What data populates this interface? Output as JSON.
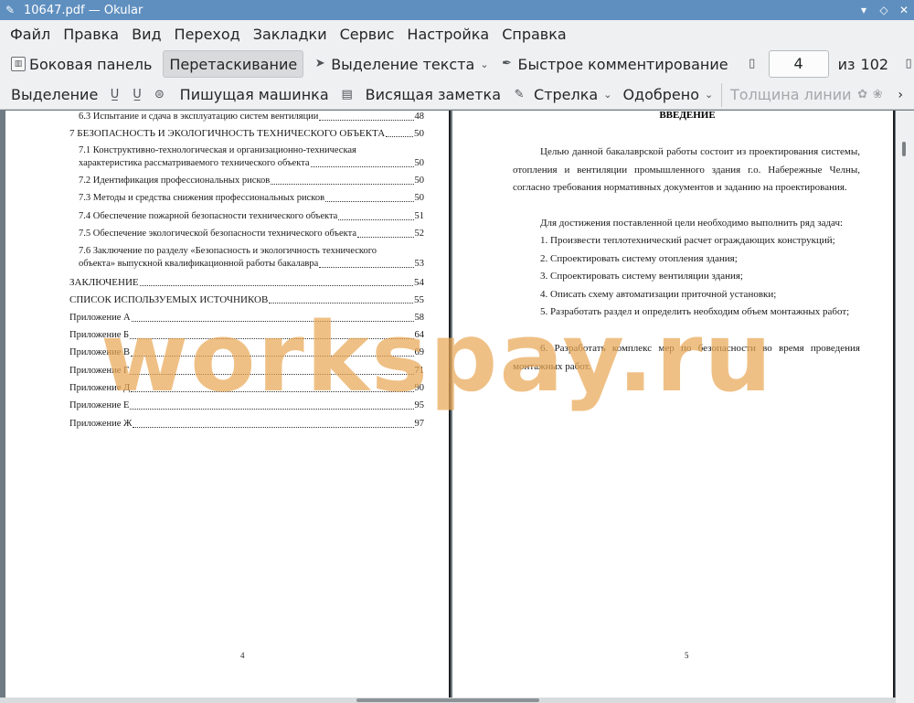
{
  "window": {
    "title": "10647.pdf  — Okular"
  },
  "menu": [
    "Файл",
    "Правка",
    "Вид",
    "Переход",
    "Закладки",
    "Сервис",
    "Настройка",
    "Справка"
  ],
  "toolbar1": {
    "sidebar": "Боковая панель",
    "drag": "Перетаскивание",
    "text_select": "Выделение текста",
    "quick_comment": "Быстрое комментирование",
    "page_current": "4",
    "page_of": "из",
    "page_total": "102"
  },
  "toolbar2": {
    "selection": "Выделение",
    "typewriter": "Пишущая машинка",
    "hanging_note": "Висящая заметка",
    "arrow": "Стрелка",
    "approved": "Одобрено",
    "line_width": "Толщина линии"
  },
  "left_page": {
    "toc": [
      {
        "text": "6.3 Испытание и сдача в эксплуатацию систем вентиляции",
        "page": "48"
      },
      {
        "text": "7 БЕЗОПАСНОСТЬ И ЭКОЛОГИЧНОСТЬ ТЕХНИЧЕСКОГО ОБЪЕКТА",
        "page": "50"
      },
      {
        "text": "7.1 Конструктивно-технологическая и организационно-техническая",
        "page": ""
      },
      {
        "text": "характеристика рассматриваемого технического объекта",
        "page": "50"
      },
      {
        "text": "7.2 Идентификация профессиональных рисков",
        "page": "50"
      },
      {
        "text": "7.3 Методы и средства снижения профессиональных рисков",
        "page": "50"
      },
      {
        "text": "7.4 Обеспечение пожарной безопасности технического объекта",
        "page": "51"
      },
      {
        "text": "7.5 Обеспечение экологической безопасности технического объекта",
        "page": "52"
      },
      {
        "text": "7.6 Заключение по разделу «Безопасность и экологичность технического",
        "page": ""
      },
      {
        "text": "объекта» выпускной квалификационной работы бакалавра",
        "page": "53"
      },
      {
        "text": "ЗАКЛЮЧЕНИЕ",
        "page": "54"
      },
      {
        "text": "СПИСОК ИСПОЛЬЗУЕМЫХ ИСТОЧНИКОВ",
        "page": "55"
      },
      {
        "text": "Приложение А",
        "page": "58"
      },
      {
        "text": "Приложение Б",
        "page": "64"
      },
      {
        "text": "Приложение В",
        "page": "69"
      },
      {
        "text": "Приложение Г",
        "page": "71"
      },
      {
        "text": "Приложение Д",
        "page": "90"
      },
      {
        "text": "Приложение Е",
        "page": "95"
      },
      {
        "text": "Приложение Ж",
        "page": "97"
      }
    ],
    "page_number": "4"
  },
  "right_page": {
    "heading": "ВВЕДЕНИЕ",
    "paragraphs": [
      "Целью данной бакалаврской работы состоит из проектирования системы, отопления и вентиляции промышленного здания г.о. Набережные Челны, согласно требования нормативных документов и заданию на проектирования.",
      "Для достижения поставленной цели необходимо выполнить ряд задач:",
      "1. Произвести теплотехнический расчет ограждающих конструкций;",
      "2. Спроектировать систему отопления здания;",
      "3. Спроектировать систему вентиляции здания;",
      "4. Описать схему автоматизации приточной установки;",
      "5. Разработать раздел и определить необходим объем монтажных работ;",
      "6. Разработать комплекс мер по безопасности во время проведения монтажных работ."
    ],
    "page_number": "5"
  },
  "watermark": "workspay.ru",
  "colors": {
    "titlebar": "#5f8fbf",
    "watermark": "#e9a856",
    "toolbar_bg": "#eff0f1"
  }
}
